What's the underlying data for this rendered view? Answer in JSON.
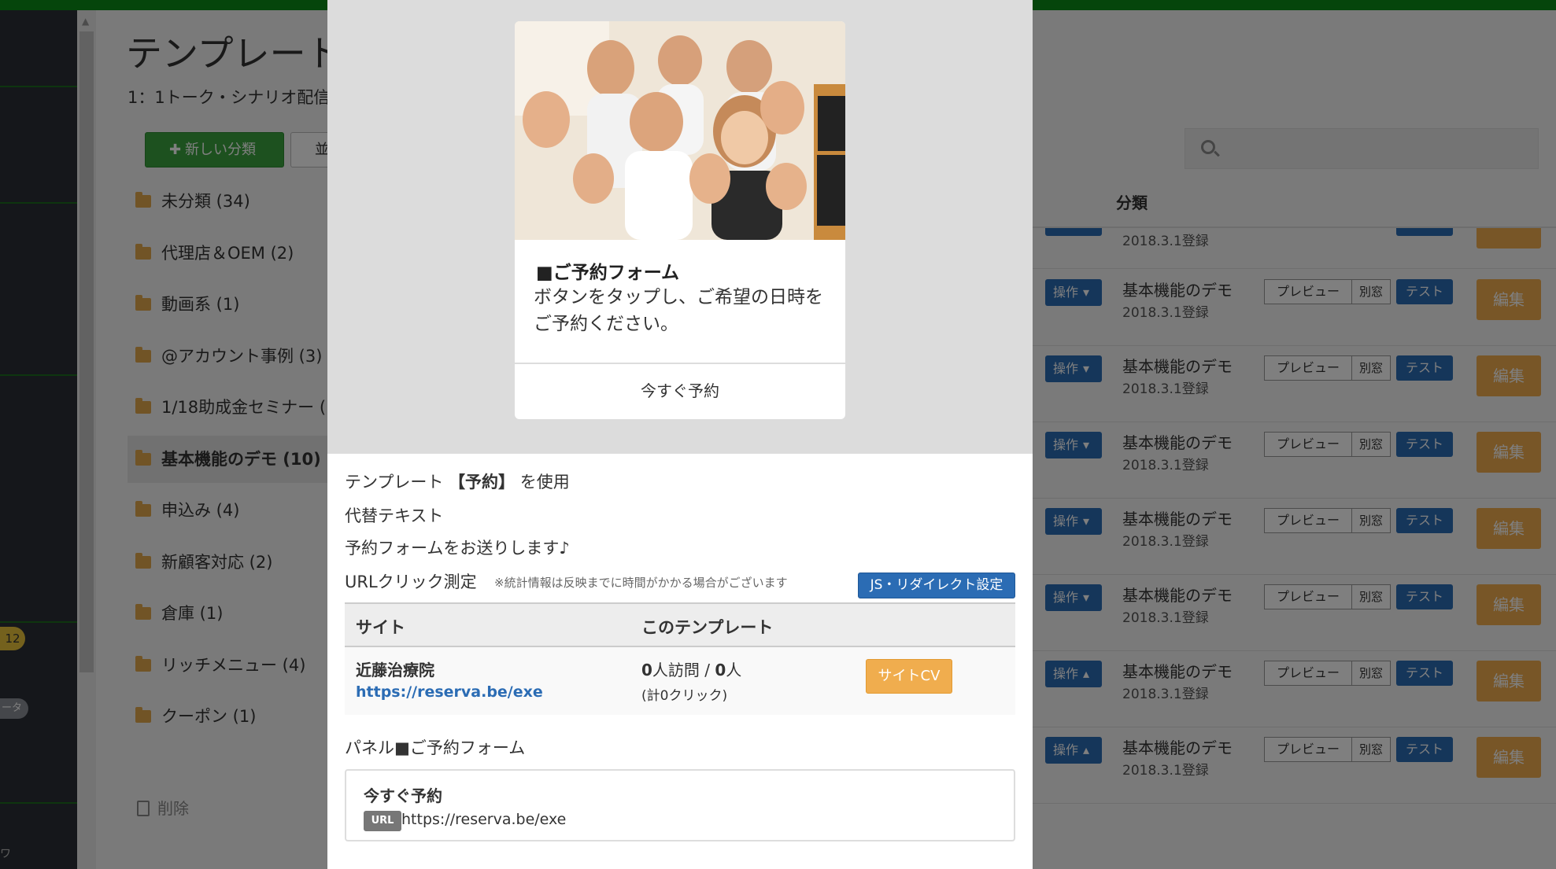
{
  "colors": {
    "topbar": "#0b8a16",
    "primary": "#2b6cb4",
    "success": "#3ba33f",
    "warning": "#f0ad4e",
    "badge": "#e8c33a"
  },
  "nav": {
    "badge_count": "12",
    "pill_text": "ータ",
    "bottom_frag": "ワ"
  },
  "page": {
    "title": "テンプレート",
    "subtitle": "1：1トーク・シナリオ配信",
    "new_category_label": "新しい分類",
    "new_category_icon": "plus-icon",
    "sort_label": "並",
    "search_icon": "search-icon"
  },
  "categories": [
    {
      "label": "未分類 (34)",
      "active": false
    },
    {
      "label": "代理店＆OEM (2)",
      "active": false
    },
    {
      "label": "動画系 (1)",
      "active": false
    },
    {
      "label": "@アカウント事例 (3)",
      "active": false
    },
    {
      "label": "1/18助成金セミナー (",
      "active": false
    },
    {
      "label": "基本機能のデモ (10)",
      "active": true
    },
    {
      "label": "申込み (4)",
      "active": false
    },
    {
      "label": "新顧客対応 (2)",
      "active": false
    },
    {
      "label": "倉庫 (1)",
      "active": false
    },
    {
      "label": "リッチメニュー (4)",
      "active": false
    },
    {
      "label": "クーポン (1)",
      "active": false
    }
  ],
  "category_delete_label": "削除",
  "table": {
    "header_category": "分類",
    "partial_row": {
      "date": "2018.3.1登録"
    },
    "rows": [
      {
        "op": "操作",
        "caret": "▾",
        "name": "基本機能のデモ",
        "date": "2018.3.1登録",
        "preview": "プレビュー",
        "window": "別窓",
        "test": "テスト",
        "edit": "編集"
      },
      {
        "op": "操作",
        "caret": "▾",
        "name": "基本機能のデモ",
        "date": "2018.3.1登録",
        "preview": "プレビュー",
        "window": "別窓",
        "test": "テスト",
        "edit": "編集"
      },
      {
        "op": "操作",
        "caret": "▾",
        "name": "基本機能のデモ",
        "date": "2018.3.1登録",
        "preview": "プレビュー",
        "window": "別窓",
        "test": "テスト",
        "edit": "編集"
      },
      {
        "op": "操作",
        "caret": "▾",
        "name": "基本機能のデモ",
        "date": "2018.3.1登録",
        "preview": "プレビュー",
        "window": "別窓",
        "test": "テスト",
        "edit": "編集"
      },
      {
        "op": "操作",
        "caret": "▾",
        "name": "基本機能のデモ",
        "date": "2018.3.1登録",
        "preview": "プレビュー",
        "window": "別窓",
        "test": "テスト",
        "edit": "編集"
      },
      {
        "op": "操作",
        "caret": "▴",
        "name": "基本機能のデモ",
        "date": "2018.3.1登録",
        "preview": "プレビュー",
        "window": "別窓",
        "test": "テスト",
        "edit": "編集"
      },
      {
        "op": "操作",
        "caret": "▴",
        "name": "基本機能のデモ",
        "date": "2018.3.1登録",
        "preview": "プレビュー",
        "window": "別窓",
        "test": "テスト",
        "edit": "編集"
      }
    ]
  },
  "modal": {
    "card": {
      "photo_name": "staff-group-photo",
      "title": "■ご予約フォーム",
      "body": "ボタンをタップし、ご希望の日時をご予約ください。",
      "action": "今すぐ予約"
    },
    "template_prefix": "テンプレート",
    "template_name": "【予約】",
    "template_suffix": "を使用",
    "alt_text_label": "代替テキスト",
    "alt_text_value": "予約フォームをお送りします♪",
    "url_click_label": "URLクリック測定",
    "url_click_note": "※統計情報は反映までに時間がかかる場合がございます",
    "js_redirect_button": "JS・リダイレクト設定",
    "stats": {
      "header_site": "サイト",
      "header_template": "このテンプレート",
      "site_name": "近藤治療院",
      "site_url": "https://reserva.be/exe",
      "visits_num": "0",
      "visits_unit": "人訪問 / ",
      "people_num": "0",
      "people_unit": "人",
      "clicks": "(計0クリック)",
      "site_cv_button": "サイトCV"
    },
    "panel_label": "パネル■ご予約フォーム",
    "panel_action": "今すぐ予約",
    "panel_url_tag": "URL",
    "panel_url": "https://reserva.be/exe"
  }
}
